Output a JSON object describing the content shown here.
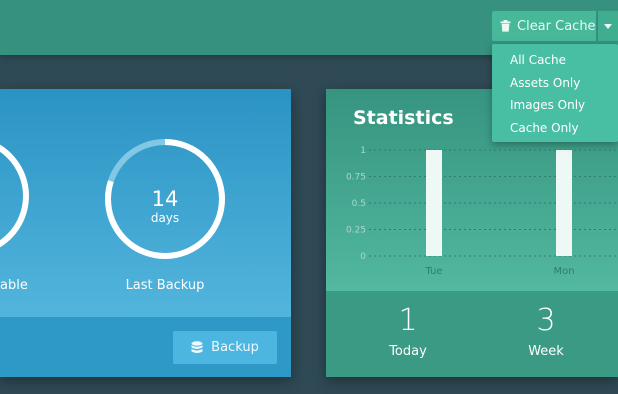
{
  "header": {
    "clear_cache_label": "Clear Cache"
  },
  "cache_menu": {
    "items": [
      "All Cache",
      "Assets Only",
      "Images Only",
      "Cache Only"
    ]
  },
  "backup_card": {
    "stat_partial_label": "able",
    "last_backup": {
      "value": "14",
      "unit": "days",
      "label": "Last Backup",
      "fill_fraction": 0.8
    },
    "backup_button_label": "Backup"
  },
  "statistics_card": {
    "title": "Statistics",
    "counts": [
      {
        "value": "1",
        "label": "Today"
      },
      {
        "value": "3",
        "label": "Week"
      }
    ]
  },
  "chart_data": {
    "type": "bar",
    "categories": [
      "Tue",
      "Mon"
    ],
    "values": [
      1,
      1
    ],
    "ylim": [
      0,
      1
    ],
    "yticks": [
      "0",
      "0.25",
      "0.5",
      "0.75",
      "1"
    ],
    "title": "",
    "xlabel": "",
    "ylabel": "",
    "grid": true
  }
}
